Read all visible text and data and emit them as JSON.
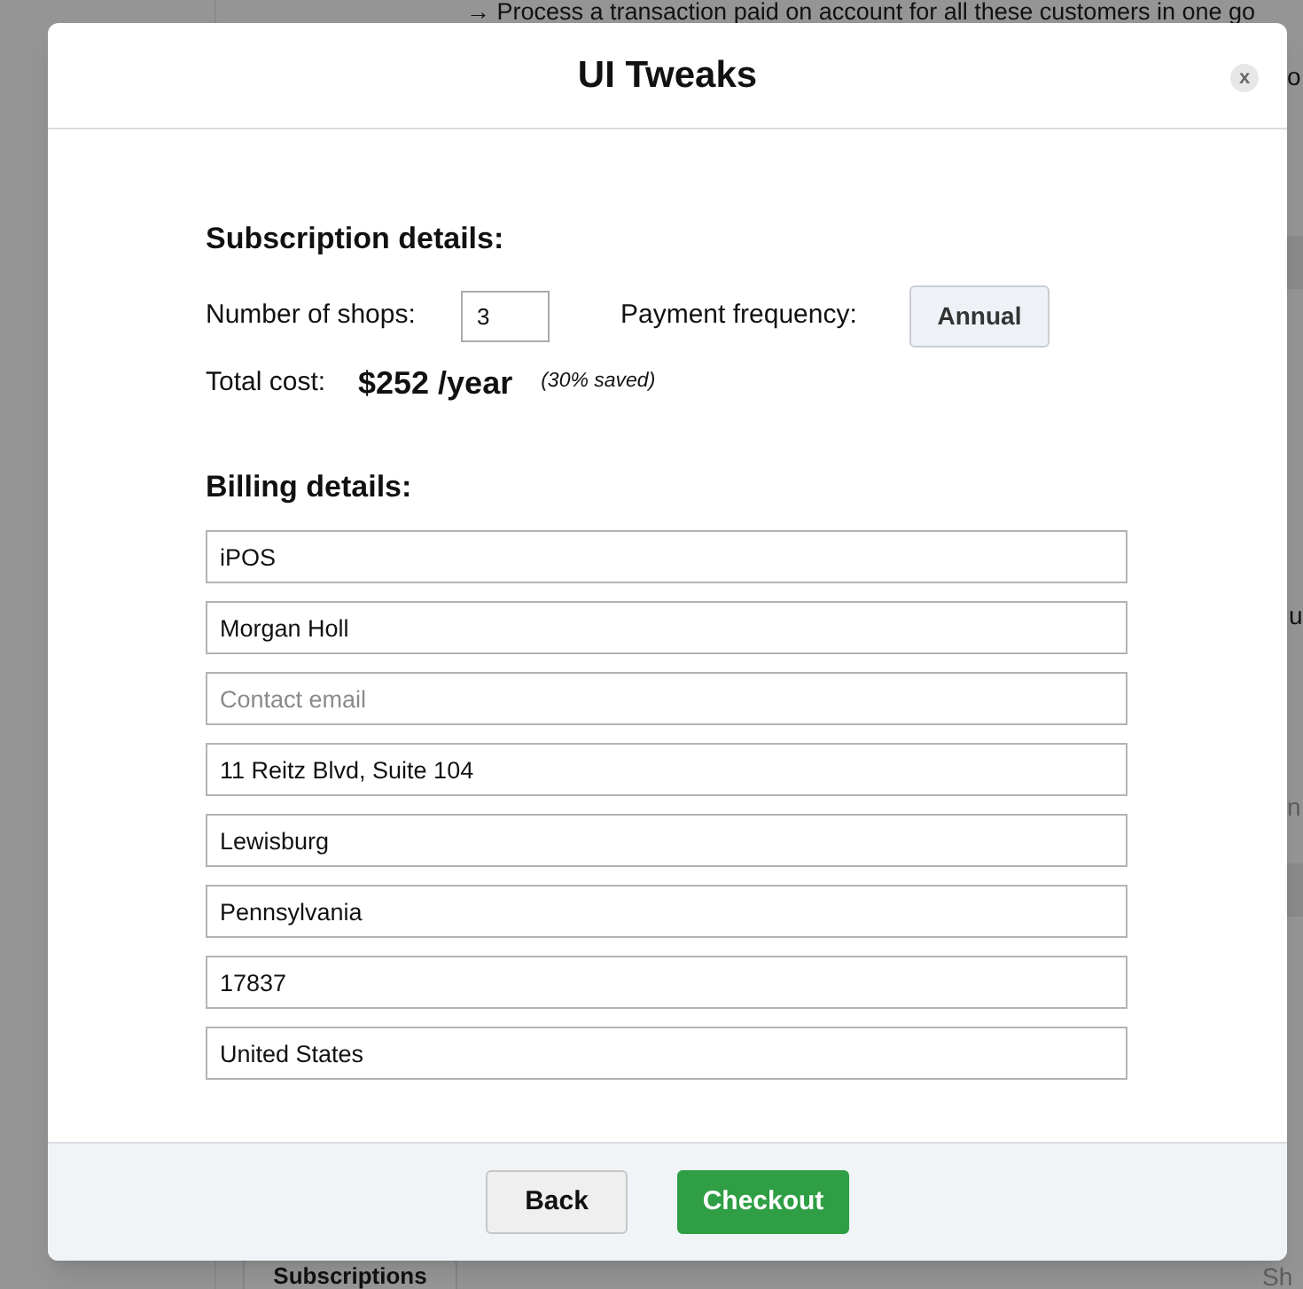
{
  "page_behind": {
    "notice": "→ Process a transaction paid on account for all these customers in one go",
    "edge_texts": [
      {
        "text": "o",
        "muted": false
      },
      {
        "text": "u",
        "muted": false
      },
      {
        "text": "n",
        "muted": true
      }
    ],
    "tab": "Subscriptions",
    "bottom_right_text": "Sh"
  },
  "dialog": {
    "title": "UI Tweaks",
    "close": "x"
  },
  "subscription": {
    "heading": "Subscription details:",
    "shops_label": "Number of shops:",
    "shops_value": "3",
    "frequency_label": "Payment frequency:",
    "frequency_button": "Annual",
    "total_label": "Total cost:",
    "total_value": "$252 /year",
    "saving": "(30% saved)"
  },
  "billing": {
    "heading": "Billing details:",
    "fields": [
      {
        "value": "iPOS"
      },
      {
        "value": "Morgan Holl"
      },
      {
        "placeholder": "Contact email"
      },
      {
        "value": "11 Reitz Blvd, Suite 104"
      },
      {
        "value": "Lewisburg"
      },
      {
        "value": "Pennsylvania"
      },
      {
        "value": "17837"
      },
      {
        "value": "United States"
      }
    ]
  },
  "footer": {
    "buttons": [
      {
        "label": "Back",
        "kind": "secondary"
      },
      {
        "label": "Checkout",
        "kind": "primary"
      }
    ]
  }
}
